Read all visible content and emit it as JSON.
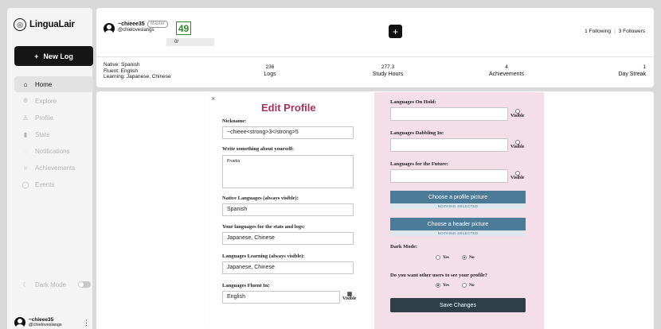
{
  "brand": {
    "name": "LinguaLair"
  },
  "sidebar": {
    "new_log": "New Log",
    "items": [
      {
        "label": "Home",
        "icon": "home-icon",
        "glyph": "⌂"
      },
      {
        "label": "Explore",
        "icon": "people-icon",
        "glyph": "ꔮ"
      },
      {
        "label": "Profile",
        "icon": "user-icon",
        "glyph": "♙"
      },
      {
        "label": "Stats",
        "icon": "chart-icon",
        "glyph": "▮"
      },
      {
        "label": "Notifications",
        "icon": "bell-icon",
        "glyph": "◌"
      },
      {
        "label": "Achievements",
        "icon": "trophy-icon",
        "glyph": "♅"
      },
      {
        "label": "Events",
        "icon": "chat-icon",
        "glyph": "◯"
      }
    ],
    "dark_mode": "Dark Mode",
    "user": {
      "name": "~chieee35",
      "handle": "@chieloveslangs"
    }
  },
  "header": {
    "user": {
      "name": "~chieee35",
      "badge": "Master",
      "handle": "@chieloveslangs"
    },
    "level": "49",
    "progress": "0/",
    "following": "1 Following",
    "followers": "3 Followers",
    "native": "Native: Spanish",
    "fluent": "Fluent: English",
    "learning": "Learning: Japanese, Chinese",
    "stats": [
      {
        "value": "236",
        "label": "Logs"
      },
      {
        "value": "277.3",
        "label": "Study Hours"
      },
      {
        "value": "4",
        "label": "Achievements"
      },
      {
        "value": "1",
        "label": "Day Streak"
      }
    ]
  },
  "modal": {
    "title": "Edit Profile",
    "nickname_label": "Nickname:",
    "nickname_value": "~chieee<strong>3</strong>5",
    "about_label": "Write something about yourself:",
    "about_value": "Prueba",
    "native_label": "Native Languages (always visible):",
    "native_value": "Spanish",
    "stats_langs_label": "Your languages for the stats and logs:",
    "stats_langs_value": "Japanese, Chinese",
    "learning_label": "Languages Learning (always visible):",
    "learning_value": "Japanese, Chinese",
    "fluent_label": "Languages Fluent In:",
    "fluent_value": "English",
    "visible": "Visible",
    "onhold_label": "Languages On Hold:",
    "dabbling_label": "Languages Dabbling In:",
    "future_label": "Languages for the Future:",
    "profile_pic_btn": "Choose a profile picture",
    "header_pic_btn": "Choose a header picture",
    "nothing_selected": "NOTHING SELECTED",
    "dark_mode_label": "Dark Mode:",
    "visibility_label": "Do you want other users to see your profile?",
    "yes": "Yes",
    "no": "No",
    "save": "Save Changes"
  }
}
